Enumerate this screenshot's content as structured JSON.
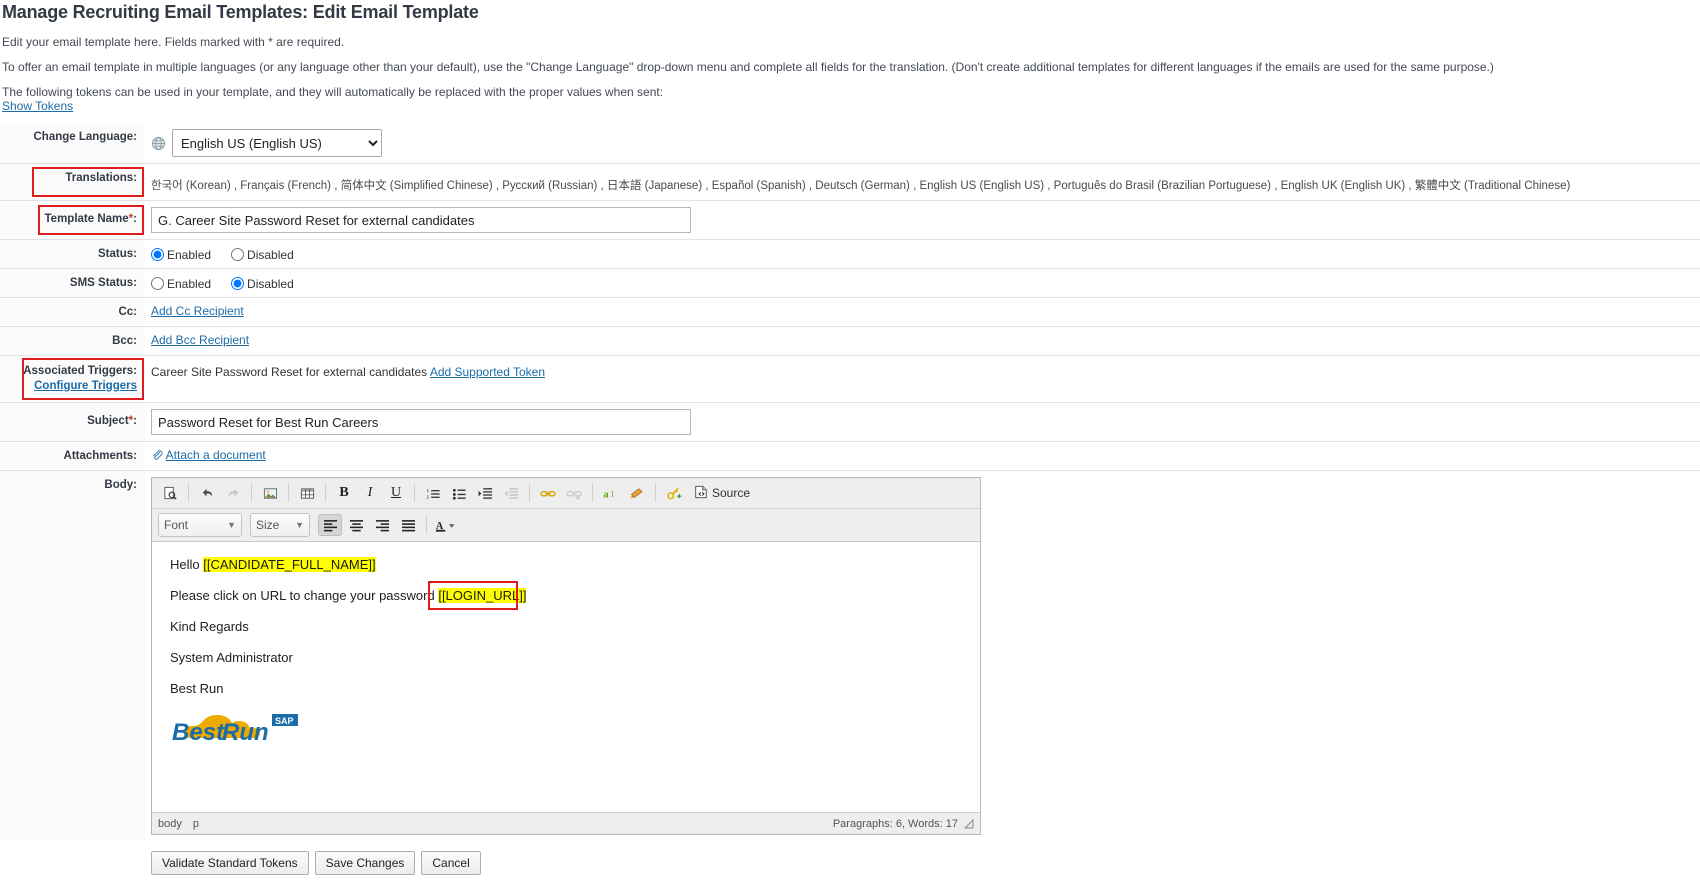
{
  "page": {
    "title": "Manage Recruiting Email Templates: Edit Email Template",
    "intro_1": "Edit your email template here. Fields marked with * are required.",
    "intro_2": "To offer an email template in multiple languages (or any language other than your default), use the \"Change Language\" drop-down menu and complete all fields for the translation. (Don't create additional templates for different languages if the emails are used for the same purpose.)",
    "intro_3": "The following tokens can be used in your template, and they will automatically be replaced with the proper values when sent:",
    "show_tokens": "Show Tokens"
  },
  "form": {
    "change_language_label": "Change Language:",
    "change_language_value": "English US (English US)",
    "change_language_options": [
      "English US (English US)"
    ],
    "translations_label": "Translations:",
    "translations_value": "한국어 (Korean) , Français (French) , 简体中文 (Simplified Chinese) , Русский (Russian) , 日本語 (Japanese) , Español (Spanish) , Deutsch (German) , English US (English US) , Português do Brasil (Brazilian Portuguese) , English UK (English UK) , 繁體中文 (Traditional Chinese)",
    "template_name_label": "Template Name",
    "template_name_value": "G. Career Site Password Reset for external candidates",
    "status_label": "Status:",
    "status_enabled": "Enabled",
    "status_disabled": "Disabled",
    "status_selected": "Enabled",
    "sms_status_label": "SMS Status:",
    "sms_enabled": "Enabled",
    "sms_disabled": "Disabled",
    "sms_selected": "Disabled",
    "cc_label": "Cc:",
    "cc_link": "Add Cc Recipient",
    "bcc_label": "Bcc:",
    "bcc_link": "Add Bcc Recipient",
    "associated_triggers_label": "Associated Triggers:",
    "configure_triggers_link": "Configure Triggers",
    "trigger_value": "Career Site Password Reset for external candidates",
    "add_supported_token_link": "Add Supported Token",
    "subject_label": "Subject",
    "subject_value": "Password Reset for Best Run Careers",
    "attachments_label": "Attachments:",
    "attach_link": "Attach a document",
    "body_label": "Body:",
    "required_mark": "*",
    "colon": ":"
  },
  "editor": {
    "toolbar_row1": [
      {
        "name": "preview-icon",
        "title": "Preview"
      },
      {
        "name": "undo-icon",
        "title": "Undo"
      },
      {
        "name": "redo-icon",
        "title": "Redo"
      },
      {
        "name": "image-icon",
        "title": "Image"
      },
      {
        "name": "table-icon",
        "title": "Table"
      },
      {
        "name": "bold-icon",
        "title": "Bold",
        "glyph": "B"
      },
      {
        "name": "italic-icon",
        "title": "Italic",
        "glyph": "I"
      },
      {
        "name": "underline-icon",
        "title": "Underline",
        "glyph": "U"
      },
      {
        "name": "numbered-list-icon",
        "title": "Insert/Remove Numbered List"
      },
      {
        "name": "bulleted-list-icon",
        "title": "Insert/Remove Bulleted List"
      },
      {
        "name": "increase-indent-icon",
        "title": "Increase Indent"
      },
      {
        "name": "decrease-indent-icon",
        "title": "Decrease Indent"
      },
      {
        "name": "link-icon",
        "title": "Link"
      },
      {
        "name": "unlink-icon",
        "title": "Unlink"
      },
      {
        "name": "spellcheck-icon",
        "title": "Spell Check"
      },
      {
        "name": "paste-from-word-icon",
        "title": "Paste from Word"
      },
      {
        "name": "insert-token-icon",
        "title": "Insert Token"
      },
      {
        "name": "source-icon",
        "title": "Source"
      }
    ],
    "source_label": "Source",
    "font_label": "Font",
    "size_label": "Size",
    "align_left": "Align Left",
    "align_center": "Center",
    "align_right": "Align Right",
    "align_justify": "Justify",
    "text_color": "Text Color",
    "body_paragraphs": [
      {
        "prefix": "Hello ",
        "token": "[[CANDIDATE_FULL_NAME]]",
        "suffix": ""
      },
      {
        "prefix": "Please click on URL to change your password ",
        "token": "[[LOGIN_URL]]",
        "suffix": ""
      },
      {
        "prefix": "Kind Regards",
        "token": "",
        "suffix": ""
      },
      {
        "prefix": "System Administrator",
        "token": "",
        "suffix": ""
      },
      {
        "prefix": "Best Run",
        "token": "",
        "suffix": ""
      }
    ],
    "logo_best": "Best",
    "logo_run": "Run",
    "logo_sap": "SAP",
    "status_element_path": [
      "body",
      "p"
    ],
    "status_counts": "Paragraphs: 6, Words: 17"
  },
  "buttons": {
    "validate": "Validate Standard Tokens",
    "save": "Save Changes",
    "cancel": "Cancel"
  },
  "colors": {
    "link": "#1b6ca8",
    "highlight_box": "#e01b1b",
    "token_highlight": "#ffff00",
    "required": "#c0392b"
  }
}
